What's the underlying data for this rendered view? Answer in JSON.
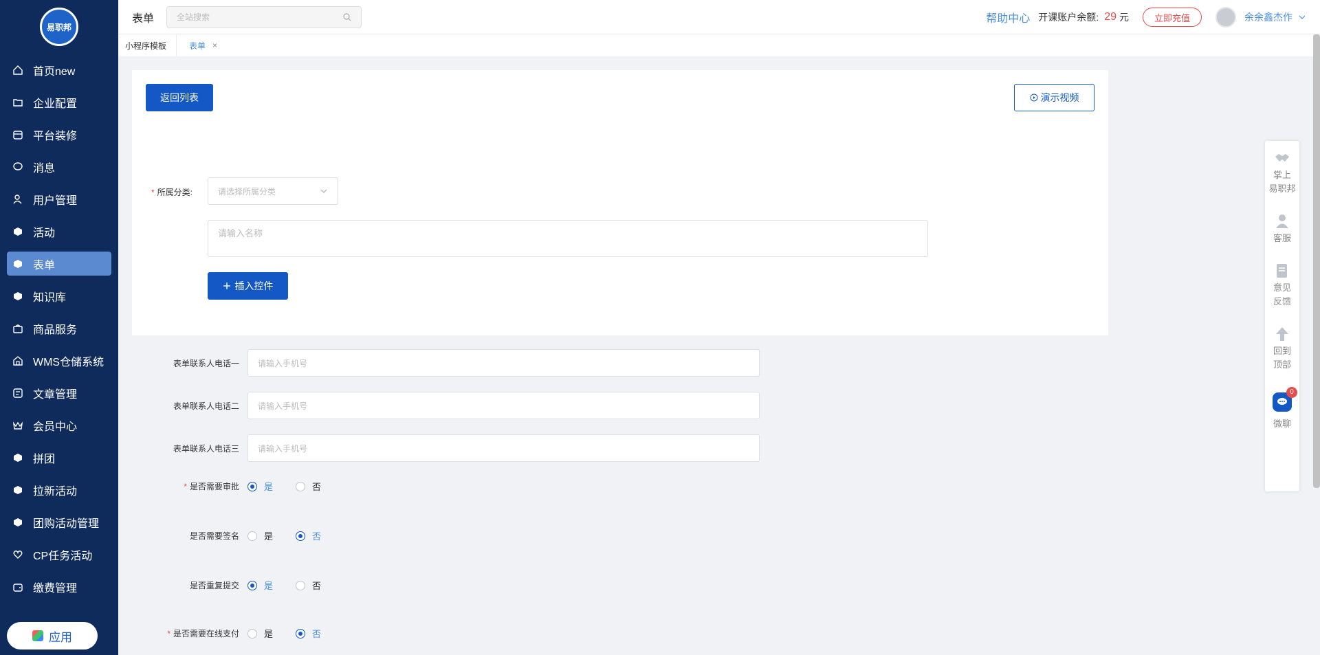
{
  "sidebar": {
    "logo_text": "易职邦",
    "items": [
      {
        "label": "首页new",
        "icon": "home-icon"
      },
      {
        "label": "企业配置",
        "icon": "folder-icon"
      },
      {
        "label": "平台装修",
        "icon": "store-icon"
      },
      {
        "label": "消息",
        "icon": "chat-bubble-icon"
      },
      {
        "label": "用户管理",
        "icon": "user-icon"
      },
      {
        "label": "活动",
        "icon": "cube-icon"
      },
      {
        "label": "表单",
        "icon": "cube-icon",
        "active": true
      },
      {
        "label": "知识库",
        "icon": "cube-icon"
      },
      {
        "label": "商品服务",
        "icon": "shop-bag-icon"
      },
      {
        "label": "WMS仓储系统",
        "icon": "warehouse-icon"
      },
      {
        "label": "文章管理",
        "icon": "article-icon"
      },
      {
        "label": "会员中心",
        "icon": "crown-icon"
      },
      {
        "label": "拼团",
        "icon": "cube-icon"
      },
      {
        "label": "拉新活动",
        "icon": "cube-icon"
      },
      {
        "label": "团购活动管理",
        "icon": "cube-icon"
      },
      {
        "label": "CP任务活动",
        "icon": "heart-icon"
      },
      {
        "label": "缴费管理",
        "icon": "wallet-icon"
      }
    ],
    "app_button": "应用"
  },
  "header": {
    "title": "表单",
    "search_placeholder": "全站搜索",
    "help": "帮助中心",
    "balance_label": "开课账户余额:",
    "balance_value": "29",
    "balance_unit": "元",
    "recharge": "立即充值",
    "username": "余余鑫杰作"
  },
  "tabs": {
    "first": "小程序模板",
    "active": "表单",
    "close": "×"
  },
  "card": {
    "back_button": "返回列表",
    "video_button": "演示视频",
    "category_label": "所属分类:",
    "category_placeholder": "请选择所属分类",
    "name_placeholder": "请输入名称",
    "insert_button": "插入控件"
  },
  "form": {
    "phone_placeholder": "请输入手机号",
    "phones": [
      "表单联系人电话一",
      "表单联系人电话二",
      "表单联系人电话三"
    ],
    "yes": "是",
    "no": "否",
    "radios": [
      {
        "label": "是否需要审批",
        "required": true,
        "selected": "yes"
      },
      {
        "label": "是否需要签名",
        "required": false,
        "selected": "no"
      },
      {
        "label": "是否重复提交",
        "required": false,
        "selected": "yes"
      },
      {
        "label": "是否需要在线支付",
        "required": true,
        "selected": "no"
      }
    ]
  },
  "float_panel": {
    "items": [
      "掌上\n易职邦",
      "客服",
      "意见\n反馈",
      "回到\n顶部",
      "微聊"
    ],
    "chat_badge": "0"
  }
}
